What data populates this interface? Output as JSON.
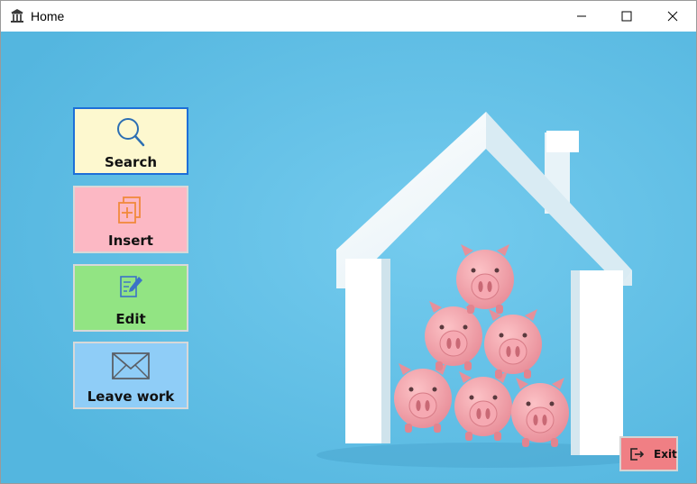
{
  "window": {
    "title": "Home",
    "app_icon": "bank-building-icon",
    "controls": [
      "minimize-icon",
      "maximize-icon",
      "close-icon"
    ]
  },
  "menu": {
    "search_label": "Search",
    "insert_label": "Insert",
    "edit_label": "Edit",
    "leave_label": "Leave work"
  },
  "exit": {
    "label": "Exit",
    "icon": "exit-door-icon"
  },
  "colors": {
    "background": "#62c0e6",
    "search_bg": "#fdf8cf",
    "insert_bg": "#fcb8c4",
    "edit_bg": "#92e483",
    "leave_bg": "#8fcdf7",
    "exit_bg": "#f07f84",
    "focus_border": "#1d6fd8"
  },
  "illustration": "white house outline with stacked pink piggy banks"
}
